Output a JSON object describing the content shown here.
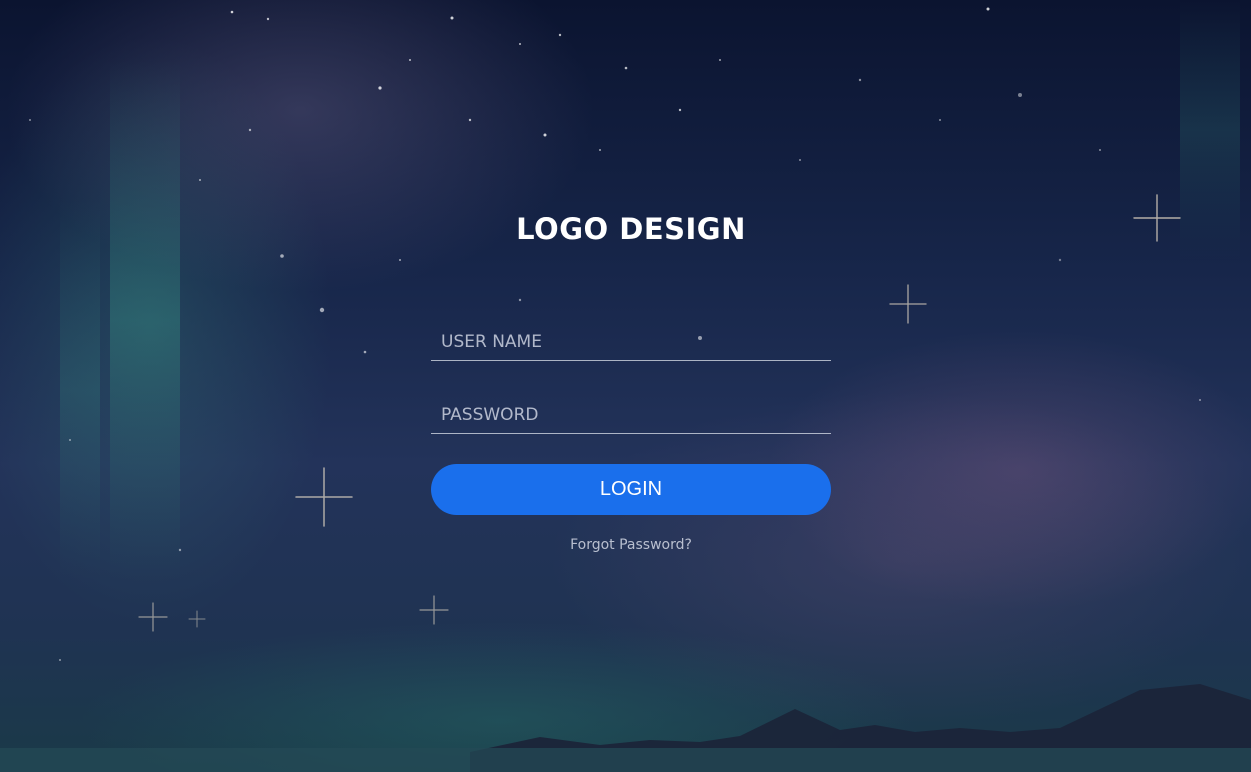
{
  "logo": {
    "text": "LOGO DESIGN"
  },
  "form": {
    "username_placeholder": "USER NAME",
    "username_value": "",
    "password_placeholder": "PASSWORD",
    "password_value": "",
    "login_label": "LOGIN",
    "forgot_label": "Forgot Password?"
  },
  "colors": {
    "accent": "#1a6fec",
    "background_top": "#0b1430",
    "background_bottom": "#1a3a48",
    "text": "#ffffff"
  }
}
